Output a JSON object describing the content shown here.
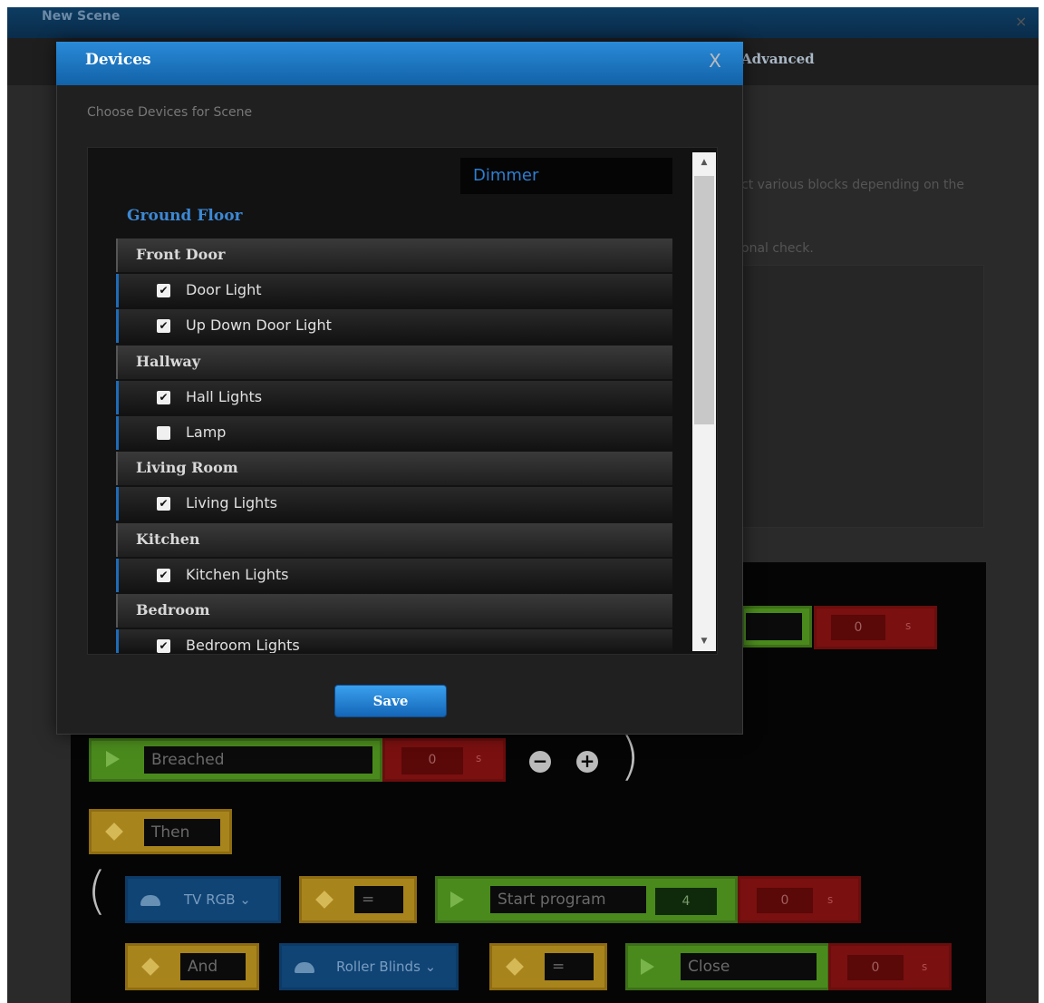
{
  "background": {
    "window_title": "New Scene",
    "close": "×",
    "tab_advanced": "Advanced",
    "desc_line1": "ct various blocks depending on the",
    "desc_line2": "onal check."
  },
  "blocks": {
    "row1": {
      "value": "0",
      "unit": "s"
    },
    "row2": {
      "condition": "Breached",
      "value": "0",
      "unit": "s",
      "minus": "−",
      "plus": "+",
      "close_paren": ")"
    },
    "row3": {
      "then": "Then"
    },
    "row4": {
      "open_paren": "(",
      "device": "TV RGB ⌄",
      "operator": "=",
      "action": "Start program",
      "param": "4",
      "value": "0",
      "unit": "s"
    },
    "row5": {
      "logic": "And",
      "device": "Roller Blinds ⌄",
      "operator": "=",
      "action": "Close",
      "value": "0",
      "unit": "s"
    }
  },
  "modal": {
    "title": "Devices",
    "close": "X",
    "subtitle": "Choose Devices for Scene",
    "filter": "Dimmer",
    "floor": "Ground Floor",
    "save": "Save",
    "rows": [
      {
        "type": "room",
        "label": "Front Door"
      },
      {
        "type": "device",
        "label": "Door Light",
        "checked": true
      },
      {
        "type": "device",
        "label": "Up Down Door Light",
        "checked": true
      },
      {
        "type": "room",
        "label": "Hallway"
      },
      {
        "type": "device",
        "label": "Hall Lights",
        "checked": true
      },
      {
        "type": "device",
        "label": "Lamp",
        "checked": false
      },
      {
        "type": "room",
        "label": "Living Room"
      },
      {
        "type": "device",
        "label": "Living Lights",
        "checked": true
      },
      {
        "type": "room",
        "label": "Kitchen"
      },
      {
        "type": "device",
        "label": "Kitchen Lights",
        "checked": true
      },
      {
        "type": "room",
        "label": "Bedroom"
      },
      {
        "type": "device",
        "label": "Bedroom Lights",
        "checked": true
      }
    ],
    "scroll_up": "▲",
    "scroll_down": "▼"
  }
}
